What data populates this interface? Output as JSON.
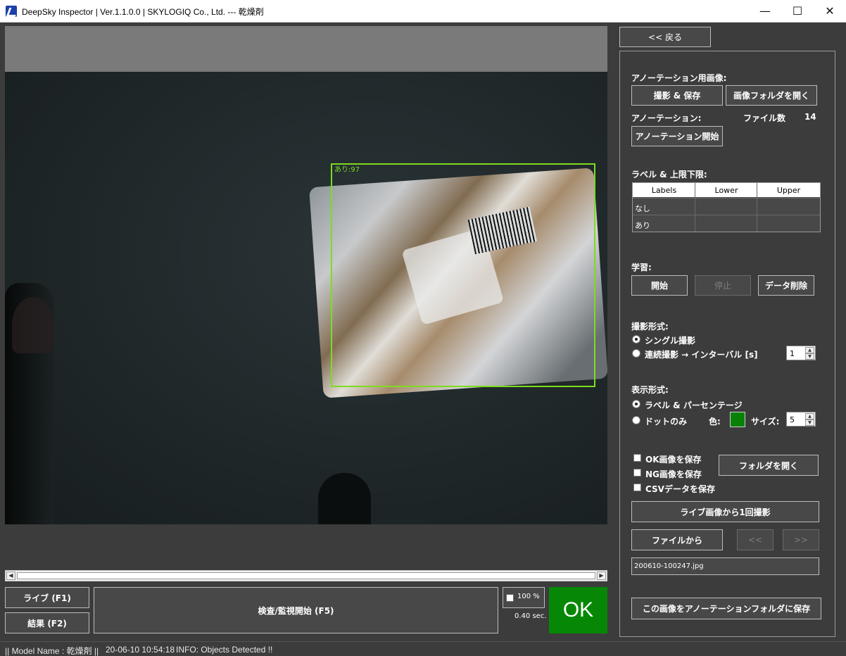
{
  "window": {
    "title": "DeepSky Inspector | Ver.1.1.0.0 | SKYLOGIQ Co., Ltd. --- 乾燥剤",
    "minimize": "—",
    "maximize": "☐",
    "close": "✕"
  },
  "viewer": {
    "detection_label": "あり:97"
  },
  "controls": {
    "live_button": "ライブ (F1)",
    "result_button": "結果 (F2)",
    "inspect_button": "検査/監視開始 (F5)",
    "zoom_percent": "100 %",
    "elapsed": "0.40 sec.",
    "result": "OK"
  },
  "status_bar": {
    "model": "|| Model Name : 乾燥剤 ||",
    "timestamp": "20-06-10 10:54:18",
    "info": "INFO:   Objects Detected !!"
  },
  "panel": {
    "back_button": "<< 戻る",
    "annotation_images_label": "アノーテーション用画像:",
    "capture_save_button": "撮影 & 保存",
    "open_image_folder_button": "画像フォルダを開く",
    "annotation_label": "アノーテーション:",
    "file_count_label": "ファイル数",
    "file_count_value": "14",
    "annotation_start_button": "アノーテーション開始",
    "labels_section": "ラベル & 上限下限:",
    "table": {
      "columns": [
        "Labels",
        "Lower",
        "Upper"
      ],
      "rows": [
        {
          "label": "なし",
          "lower": "",
          "upper": ""
        },
        {
          "label": "あり",
          "lower": "",
          "upper": ""
        }
      ]
    },
    "learning_label": "学習:",
    "learn_start": "開始",
    "learn_stop": "停止",
    "delete_data": "データ削除",
    "capture_mode_label": "撮影形式:",
    "single_capture": "シングル撮影",
    "continuous_capture": "連続撮影 → インターバル [s]",
    "interval_value": "1",
    "display_mode_label": "表示形式:",
    "label_percentage": "ラベル & パーセンテージ",
    "dot_only": "ドットのみ",
    "color_label": "色:",
    "dot_color": "#078207",
    "size_label": "サイズ:",
    "size_value": "5",
    "save_ok": "OK画像を保存",
    "save_ng": "NG画像を保存",
    "save_csv": "CSVデータを保存",
    "open_folder_button": "フォルダを開く",
    "capture_once_button": "ライブ画像から1回撮影",
    "from_file_button": "ファイルから",
    "prev_button": "<<",
    "next_button": ">>",
    "current_file": "200610-100247.jpg",
    "save_to_annotation_button": "この画像をアノーテーションフォルダに保存"
  }
}
